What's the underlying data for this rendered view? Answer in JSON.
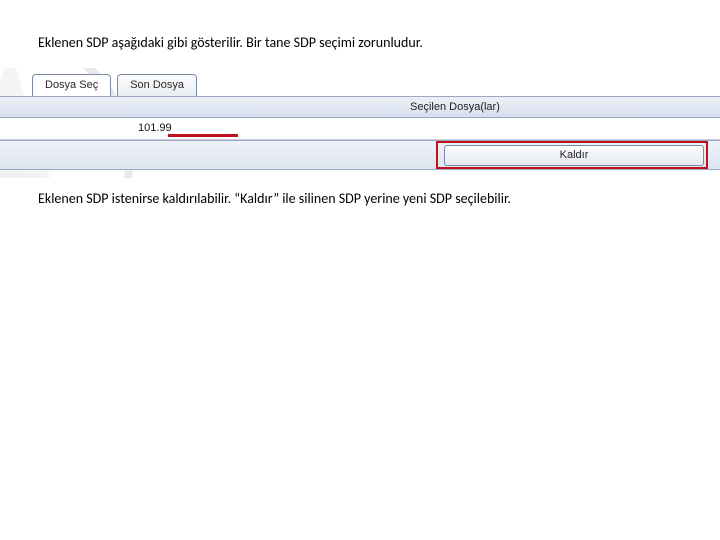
{
  "caption_top": "Eklenen SDP aşağıdaki gibi gösterilir. Bir tane SDP seçimi zorunludur.",
  "caption_bottom": "Eklenen SDP istenirse kaldırılabilir. “Kaldır” ile silinen SDP yerine yeni SDP seçilebilir.",
  "tabs": {
    "select_file": "Dosya Seç",
    "last_file": "Son Dosya"
  },
  "table": {
    "header_selected_files": "Seçilen Dosya(lar)",
    "row_value": "101.99"
  },
  "buttons": {
    "remove": "Kaldır"
  }
}
